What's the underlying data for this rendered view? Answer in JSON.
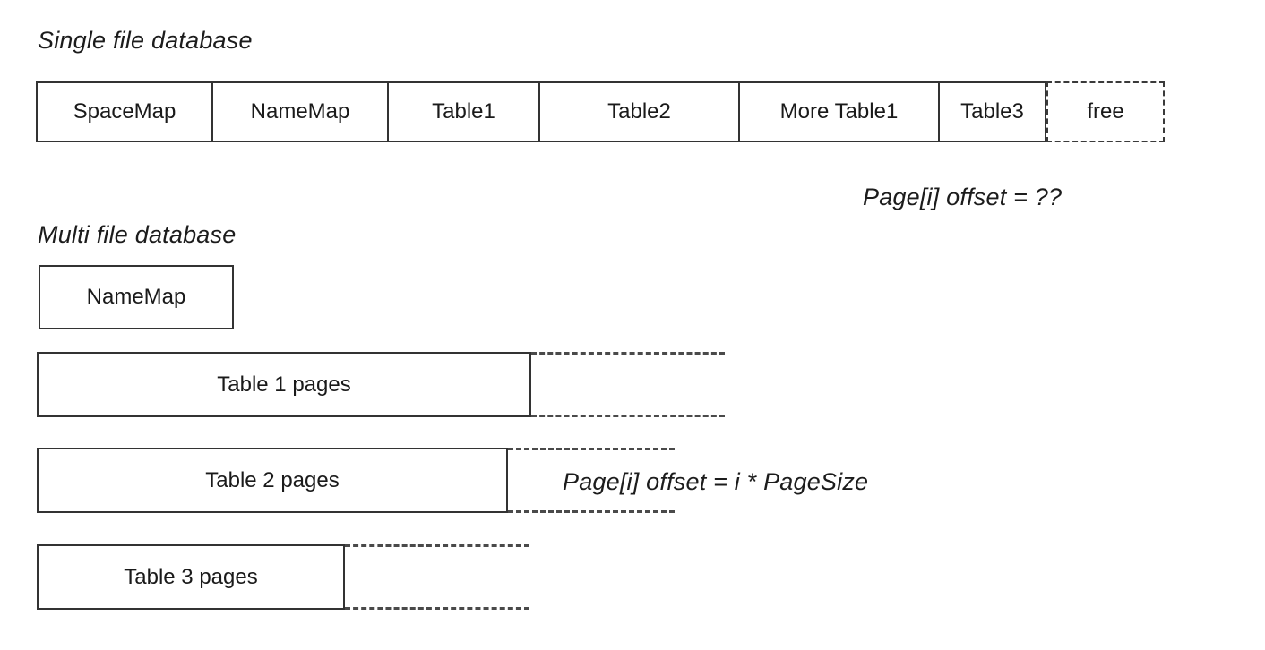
{
  "diagram": {
    "title_single": "Single file database",
    "title_multi": "Multi file database",
    "single_file": {
      "cells": [
        {
          "label": "SpaceMap",
          "style": "solid"
        },
        {
          "label": "NameMap",
          "style": "solid"
        },
        {
          "label": "Table1",
          "style": "solid"
        },
        {
          "label": "Table2",
          "style": "solid"
        },
        {
          "label": "More Table1",
          "style": "solid"
        },
        {
          "label": "Table3",
          "style": "solid"
        },
        {
          "label": "free",
          "style": "dashed"
        }
      ],
      "offset_formula": "Page[i] offset = ??"
    },
    "multi_file": {
      "name_map_label": "NameMap",
      "files": [
        {
          "label": "Table 1 pages"
        },
        {
          "label": "Table 2 pages"
        },
        {
          "label": "Table 3 pages"
        }
      ],
      "offset_formula": "Page[i] offset = i * PageSize"
    },
    "colors": {
      "stroke": "#333333",
      "dashed_stroke": "#4a4a4a",
      "text": "#1a1a1a",
      "background": "#ffffff"
    }
  }
}
